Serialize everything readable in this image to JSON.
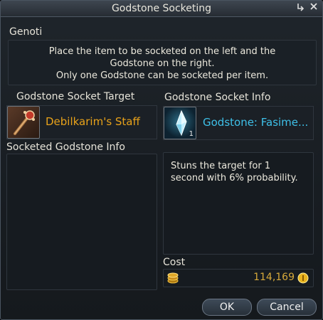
{
  "window": {
    "title": "Godstone Socketing"
  },
  "genoti": {
    "label": "Genoti"
  },
  "notice": {
    "line1": "Place the item to be socketed on the left and the",
    "line2": "Godstone on the right.",
    "line3": "Only one Godstone can be socketed per item."
  },
  "target": {
    "label": "Godstone Socket Target",
    "item_name": "Debilkarim's Staff",
    "item_color": "#e8a21a"
  },
  "info": {
    "label": "Godstone Socket Info",
    "godstone_name": "Godstone: Fasime...",
    "godstone_color": "#3ec0e8",
    "quantity": "1",
    "description": "Stuns the target for 1 second with 6% probability."
  },
  "socketed": {
    "label": "Socketed Godstone Info"
  },
  "cost": {
    "label": "Cost",
    "value": "114,169"
  },
  "buttons": {
    "ok": "OK",
    "cancel": "Cancel"
  },
  "icons": {
    "pin": "pin-icon",
    "close": "close-icon",
    "staff": "staff-icon",
    "godstone": "godstone-icon",
    "coins": "coin-stack-icon",
    "kinah": "kinah-coin-icon"
  }
}
